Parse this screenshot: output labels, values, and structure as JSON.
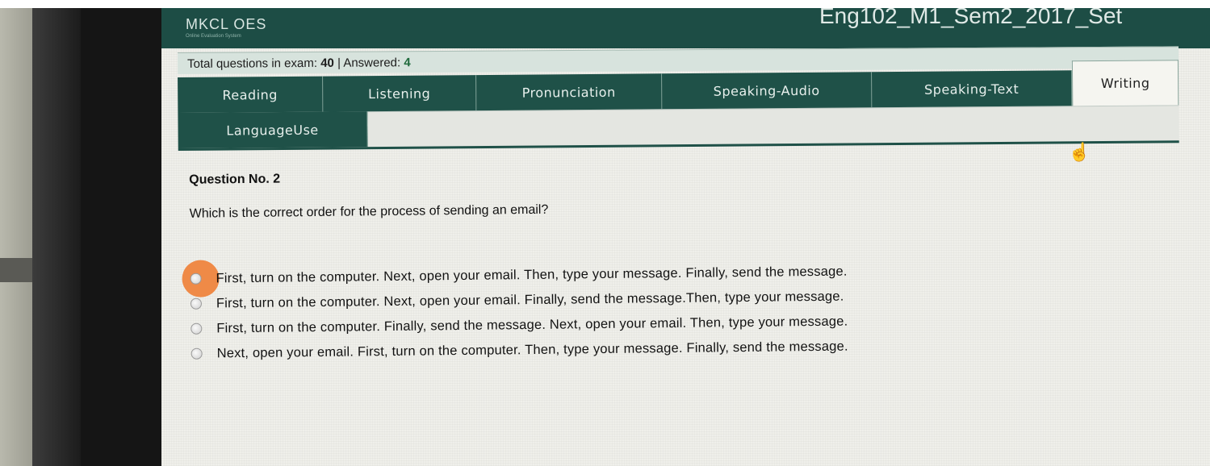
{
  "header": {
    "logo": "MKCL OES",
    "logo_subtitle": "Online Evaluation System",
    "exam_title": "Eng102_M1_Sem2_2017_Set"
  },
  "stats": {
    "total_label": "Total questions in exam:",
    "total_value": "40",
    "separator": "|",
    "answered_label": "Answered:",
    "answered_value": "4"
  },
  "tabs": [
    {
      "label": "Reading"
    },
    {
      "label": "Listening"
    },
    {
      "label": "Pronunciation"
    },
    {
      "label": "Speaking-Audio"
    },
    {
      "label": "Speaking-Text"
    },
    {
      "label": "Writing",
      "active": true
    },
    {
      "label": "LanguageUse"
    }
  ],
  "question": {
    "number_label": "Question No. 2",
    "text": "Which is the correct order for the process of sending an email?",
    "options": [
      {
        "label": "First, turn on the computer. Next, open your email. Then, type your message. Finally, send the message.",
        "selected": true
      },
      {
        "label": "First, turn on the computer. Next, open your email. Finally, send the message.Then, type your message.",
        "selected": false
      },
      {
        "label": "First, turn on the computer. Finally, send the message. Next, open your email. Then, type your message.",
        "selected": false
      },
      {
        "label": "Next, open your email. First, turn on the computer. Then, type your message. Finally, send the message.",
        "selected": false
      }
    ]
  },
  "colors": {
    "header_green": "#1d4d45",
    "tab_green": "#1f5148",
    "marker_orange": "#ef8a47"
  },
  "icons": {
    "cursor": "hand-pointer-icon"
  }
}
